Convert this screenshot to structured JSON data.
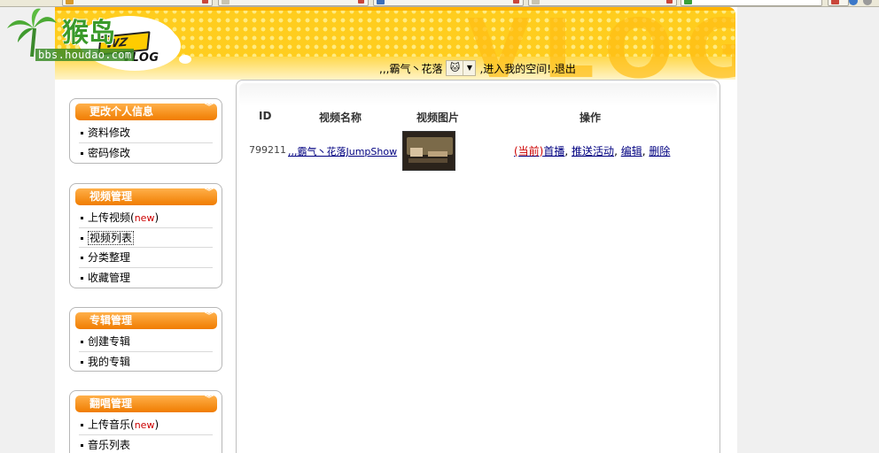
{
  "header": {
    "bg_word": "VLOG",
    "logo_text": "VLOG",
    "logo_mark": "WZ",
    "watermark_text": "猴岛",
    "watermark_url": "bbs.houdao.com",
    "username": ",,,霸气丶花落",
    "welcome_text": ",进入我的空间!",
    "logout": "退出",
    "sep": ","
  },
  "sidebar": {
    "panels": [
      {
        "title": "更改个人信息",
        "items": [
          {
            "label": "资料修改"
          },
          {
            "label": "密码修改"
          }
        ]
      },
      {
        "title": "视频管理",
        "items": [
          {
            "label": "上传视频",
            "new": "new"
          },
          {
            "label": "视频列表"
          },
          {
            "label": "分类整理"
          },
          {
            "label": "收藏管理"
          }
        ]
      },
      {
        "title": "专辑管理",
        "items": [
          {
            "label": "创建专辑"
          },
          {
            "label": "我的专辑"
          }
        ]
      },
      {
        "title": "翻唱管理",
        "items": [
          {
            "label": "上传音乐",
            "new": "new"
          },
          {
            "label": "音乐列表"
          }
        ]
      }
    ]
  },
  "table": {
    "columns": [
      "ID",
      "视频名称",
      "视频图片",
      "操作"
    ],
    "rows": [
      {
        "id": "799211",
        "name": ",,,霸气丶花落JumpShow",
        "ops": {
          "current": "(当前)",
          "broadcast": "首播",
          "push": "推送活动",
          "edit": "编辑",
          "delete": "删除",
          "sep": ","
        }
      }
    ]
  },
  "colors": {
    "header_yellow": "#ffcd1e",
    "panel_orange": "#f07c00",
    "link_blue": "#000080",
    "new_red": "#cc0000"
  }
}
